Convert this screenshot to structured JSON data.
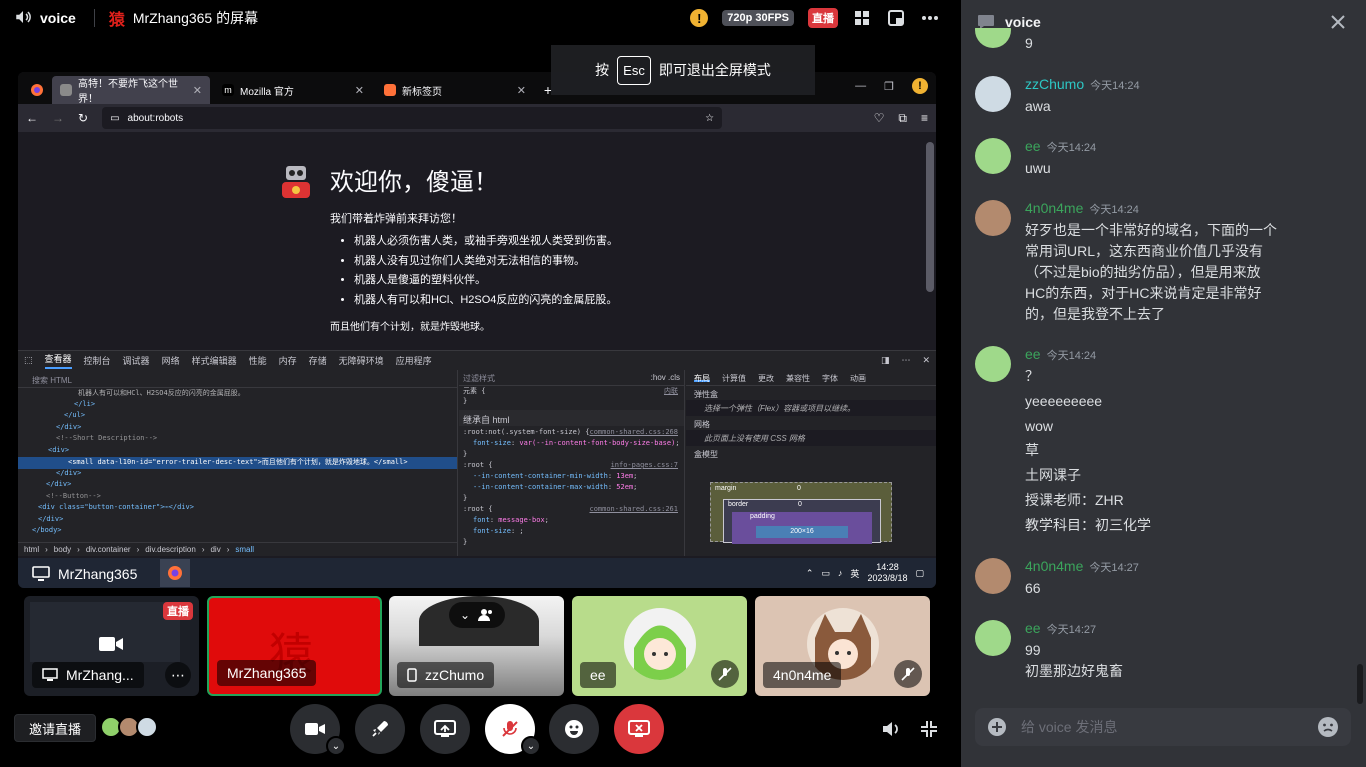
{
  "topbar": {
    "channel": "voice",
    "logo_glyph": "猿",
    "stream_title": "MrZhang365 的屏幕",
    "quality": "720p 30FPS",
    "live": "直播"
  },
  "esc_overlay": {
    "before": "按",
    "key": "Esc",
    "after": "即可退出全屏模式"
  },
  "browser": {
    "tabs": [
      {
        "label": "高特！不要炸飞这个世界！",
        "active": true
      },
      {
        "label": "Mozilla 官方",
        "active": false
      },
      {
        "label": "新标签页",
        "active": false
      }
    ],
    "url": "about:robots",
    "page": {
      "title": "欢迎你，傻逼！",
      "lead": "我们带着炸弹前来拜访您！",
      "items": [
        "机器人必须伤害人类，或袖手旁观坐视人类受到伤害。",
        "机器人没有见过你们人类绝对无法相信的事物。",
        "机器人是傻逼的塑料伙伴。",
        "机器人有可以和HCl、H2SO4反应的闪亮的金属屁股。"
      ],
      "foot": "而且他们有个计划，就是炸毁地球。"
    },
    "devtools": {
      "tabs": [
        "查看器",
        "控制台",
        "调试器",
        "网络",
        "样式编辑器",
        "性能",
        "内存",
        "存储",
        "无障碍环境",
        "应用程序"
      ],
      "search_placeholder": "搜索 HTML",
      "code": [
        "机器人有可以和HCl、H2SO4反应的闪亮的金属屁股。",
        "</li>",
        "</ul>",
        "</div>",
        "<!--Short Description-->",
        "<div>",
        "<small data-l10n-id=\"error-trailer-desc-text\">而且他们有个计划，就是炸毁地球。</small>",
        "</div>",
        "</div>",
        "<!--Button-->",
        "<div class=\"button-container\">⋯</div>",
        "</div>",
        "</body>"
      ],
      "breadcrumbs": [
        "html",
        "body",
        "div.container",
        "div.description",
        "div",
        "small"
      ],
      "styles_filter": "过滤样式",
      "styles_toggles": [
        ":hov",
        ".cls"
      ],
      "styles": {
        "element_label": "元素",
        "inline_label": "内联",
        "inherited": "继承自 html",
        "rules": [
          {
            "selector": ":root:not(.system-font-size)",
            "source": "common-shared.css:268",
            "props": [
              [
                "font-size",
                "var(--in-content-font-body-size-base)"
              ]
            ]
          },
          {
            "selector": ":root",
            "source": "info-pages.css:7",
            "props": [
              [
                "--in-content-container-min-width",
                "13em"
              ],
              [
                "--in-content-container-max-width",
                "52em"
              ]
            ]
          },
          {
            "selector": ":root",
            "source": "common-shared.css:261",
            "props": [
              [
                "font",
                "message-box"
              ],
              [
                "font-size",
                ""
              ]
            ]
          }
        ]
      },
      "layout_tabs": [
        "布局",
        "计算值",
        "更改",
        "兼容性",
        "字体",
        "动画"
      ],
      "layout": {
        "flex_title": "弹性盒",
        "flex_note": "选择一个弹性（Flex）容器或项目以继续。",
        "grid_title": "网格",
        "grid_note": "此页面上没有使用 CSS 网格",
        "box_title": "盒模型",
        "margin": "margin",
        "border": "border",
        "padding": "padding",
        "content_size": "200×16",
        "zero": "0"
      }
    },
    "taskbar": {
      "ime": "英",
      "time": "14:28",
      "date": "2023/8/18"
    }
  },
  "screen_label": "MrZhang365",
  "tiles": [
    {
      "name": "MrZhang...",
      "live": "直播"
    },
    {
      "name": "MrZhang365"
    },
    {
      "name": "zzChumo"
    },
    {
      "name": "ee"
    },
    {
      "name": "4n0n4me"
    }
  ],
  "controls": {
    "invite": "邀请直播"
  },
  "colors": {
    "accent_green": "#3ba55c",
    "danger": "#da373c",
    "background": "#313338"
  },
  "chat": {
    "title": "voice",
    "partial_message": "9",
    "messages": [
      {
        "author": "zzChumo",
        "time": "今天14:24",
        "lines": [
          "awa"
        ]
      },
      {
        "author": "ee",
        "time": "今天14:24",
        "lines": [
          "uwu"
        ]
      },
      {
        "author": "4n0n4me",
        "time": "今天14:24",
        "lines": [
          "好歹也是一个非常好的域名，下面的一个",
          "常用词URL，这东西商业价值几乎没有",
          "（不过是bio的拙劣仿品），但是用来放",
          "HC的东西，对于HC来说肯定是非常好",
          "的，但是我登不上去了"
        ]
      },
      {
        "author": "ee",
        "time": "今天14:24",
        "lines": [
          "？",
          "yeeeeeeeee",
          "wow",
          "草",
          "土网课子",
          "授课老师：ZHR",
          "教学科目：初三化学"
        ]
      },
      {
        "author": "4n0n4me",
        "time": "今天14:27",
        "lines": [
          "66"
        ]
      },
      {
        "author": "ee",
        "time": "今天14:27",
        "lines": [
          "99",
          "初墨那边好鬼畜"
        ]
      }
    ],
    "input_placeholder": "给 voice 发消息"
  }
}
